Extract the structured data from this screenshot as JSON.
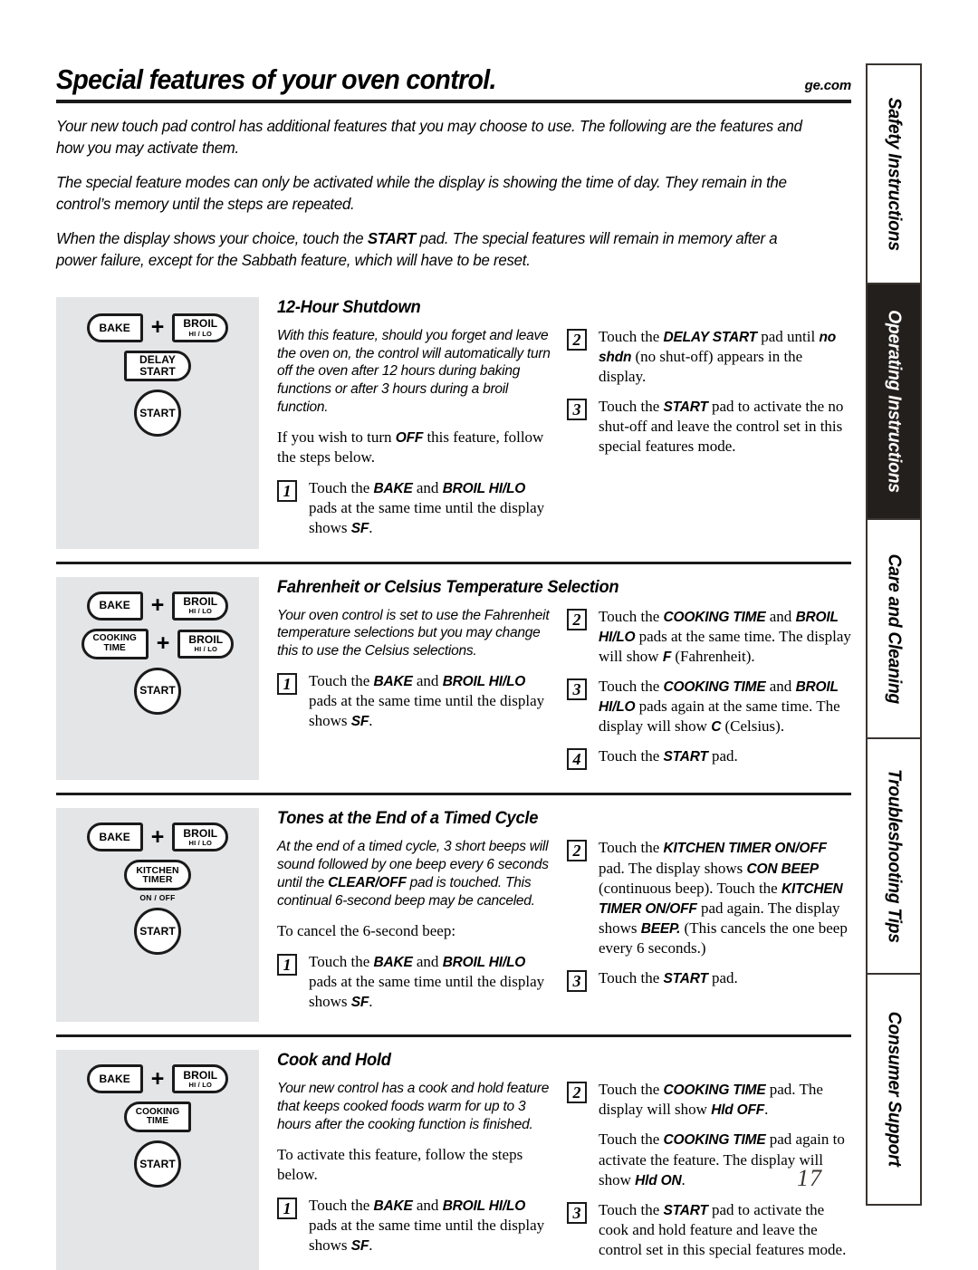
{
  "header": {
    "title": "Special features of your oven control.",
    "site": "ge.com"
  },
  "intro": [
    "Your new touch pad control has additional features that you may choose to use. The following are the features and how you may activate them.",
    "The special feature modes can only be activated while the display is showing the time of day. They remain in the control’s memory until the steps are repeated.",
    "When the display shows your choice, touch the START pad. The special features will remain in memory after a power failure, except for the Sabbath feature, which will have to be reset."
  ],
  "intro3": {
    "a": "When the display shows your choice, touch the ",
    "bold": "START",
    "b": " pad. The special features will remain in memory after a power failure, except for the Sabbath feature, which will have to be reset."
  },
  "pads": {
    "bake": "BAKE",
    "broil": "BROIL",
    "broil_sub": "HI / LO",
    "delay": "DELAY",
    "delay2": "START",
    "start": "START",
    "cooking": "COOKING",
    "cooking2": "TIME",
    "kitchen": "KITCHEN",
    "kitchen2": "TIMER",
    "onoff": "ON / OFF",
    "plus": "+"
  },
  "sections": [
    {
      "title": "12-Hour Shutdown",
      "left_italic": "With this feature, should you forget and leave the oven on, the control will automatically turn off the oven after 12 hours during baking functions or after 3 hours during a broil function.",
      "left_serif_a": "If you wish to turn ",
      "left_serif_bold": "OFF",
      "left_serif_b": " this feature, follow the steps below.",
      "steps_left": [
        {
          "num": "1",
          "parts": [
            "Touch the ",
            "BAKE",
            " and ",
            "BROIL HI/LO",
            " pads at the same time until the display shows ",
            "SF",
            "."
          ]
        }
      ],
      "steps_right": [
        {
          "num": "2",
          "parts": [
            "Touch the ",
            "DELAY START",
            " pad until ",
            "no shdn",
            " (no shut-off) appears in the display."
          ]
        },
        {
          "num": "3",
          "parts": [
            "Touch the ",
            "START",
            " pad to activate the no shut-off and leave the control set in this special features mode."
          ]
        }
      ]
    },
    {
      "title": "Fahrenheit or Celsius Temperature Selection",
      "left_italic": "Your oven control is set to use the Fahrenheit temperature selections but you may change this to use the Celsius selections.",
      "steps_left": [
        {
          "num": "1",
          "parts": [
            "Touch the ",
            "BAKE",
            " and ",
            "BROIL HI/LO",
            " pads at the same time until the display shows ",
            "SF",
            "."
          ]
        }
      ],
      "steps_right": [
        {
          "num": "2",
          "parts": [
            "Touch the ",
            "COOKING TIME",
            " and ",
            "BROIL HI/LO",
            " pads at the same time. The display will show ",
            "F",
            " (Fahrenheit)."
          ]
        },
        {
          "num": "3",
          "parts": [
            "Touch the ",
            "COOKING TIME",
            " and ",
            "BROIL HI/LO",
            " pads again at the same time. The display will show ",
            "C",
            " (Celsius)."
          ]
        },
        {
          "num": "4",
          "parts": [
            "Touch the ",
            "START",
            " pad."
          ]
        }
      ]
    },
    {
      "title": "Tones at the End of a Timed Cycle",
      "left_italic_a": "At the end of a timed cycle, 3 short beeps will sound followed by one beep every 6 seconds until the ",
      "left_italic_bold": "CLEAR/OFF",
      "left_italic_b": " pad is touched. This continual 6-second beep may be canceled.",
      "left_serif": "To cancel the 6-second beep:",
      "steps_left": [
        {
          "num": "1",
          "parts": [
            "Touch the ",
            "BAKE",
            " and ",
            "BROIL HI/LO",
            " pads at the same time until the display shows ",
            "SF",
            "."
          ]
        }
      ],
      "steps_right": [
        {
          "num": "2",
          "parts": [
            "Touch the ",
            "KITCHEN TIMER ON/OFF",
            " pad. The display shows ",
            "CON BEEP",
            " (continuous beep). Touch the ",
            "KITCHEN TIMER ON/OFF",
            " pad again. The display shows ",
            "BEEP.",
            " (This cancels the one beep every 6 seconds.)"
          ]
        },
        {
          "num": "3",
          "parts": [
            "Touch the ",
            "START",
            " pad."
          ]
        }
      ]
    },
    {
      "title": "Cook and Hold",
      "left_italic": "Your new control has a cook and hold feature that keeps cooked foods warm for up to 3 hours after the cooking function is finished.",
      "left_serif": "To activate this feature, follow the steps below.",
      "steps_left": [
        {
          "num": "1",
          "parts": [
            "Touch the ",
            "BAKE",
            " and ",
            "BROIL HI/LO",
            " pads at the same time until the display shows ",
            "SF",
            "."
          ]
        }
      ],
      "steps_right": [
        {
          "num": "2",
          "parts": [
            "Touch the ",
            "COOKING TIME",
            " pad. The display will show ",
            "Hld OFF",
            "."
          ]
        },
        {
          "num": "3",
          "parts": [
            "Touch the ",
            "START",
            " pad to activate the cook and hold feature and leave the control set in this special features mode."
          ]
        }
      ],
      "substep": {
        "a": "Touch the ",
        "bold1": "COOKING TIME",
        "b": " pad again to activate the feature. The display will show ",
        "bold2": "Hld ON",
        "c": "."
      }
    }
  ],
  "tabs": [
    {
      "label": "Safety Instructions",
      "active": false
    },
    {
      "label": "Operating Instructions",
      "active": true
    },
    {
      "label": "Care and Cleaning",
      "active": false
    },
    {
      "label": "Troubleshooting Tips",
      "active": false
    },
    {
      "label": "Consumer Support",
      "active": false
    }
  ],
  "page_number": "17"
}
